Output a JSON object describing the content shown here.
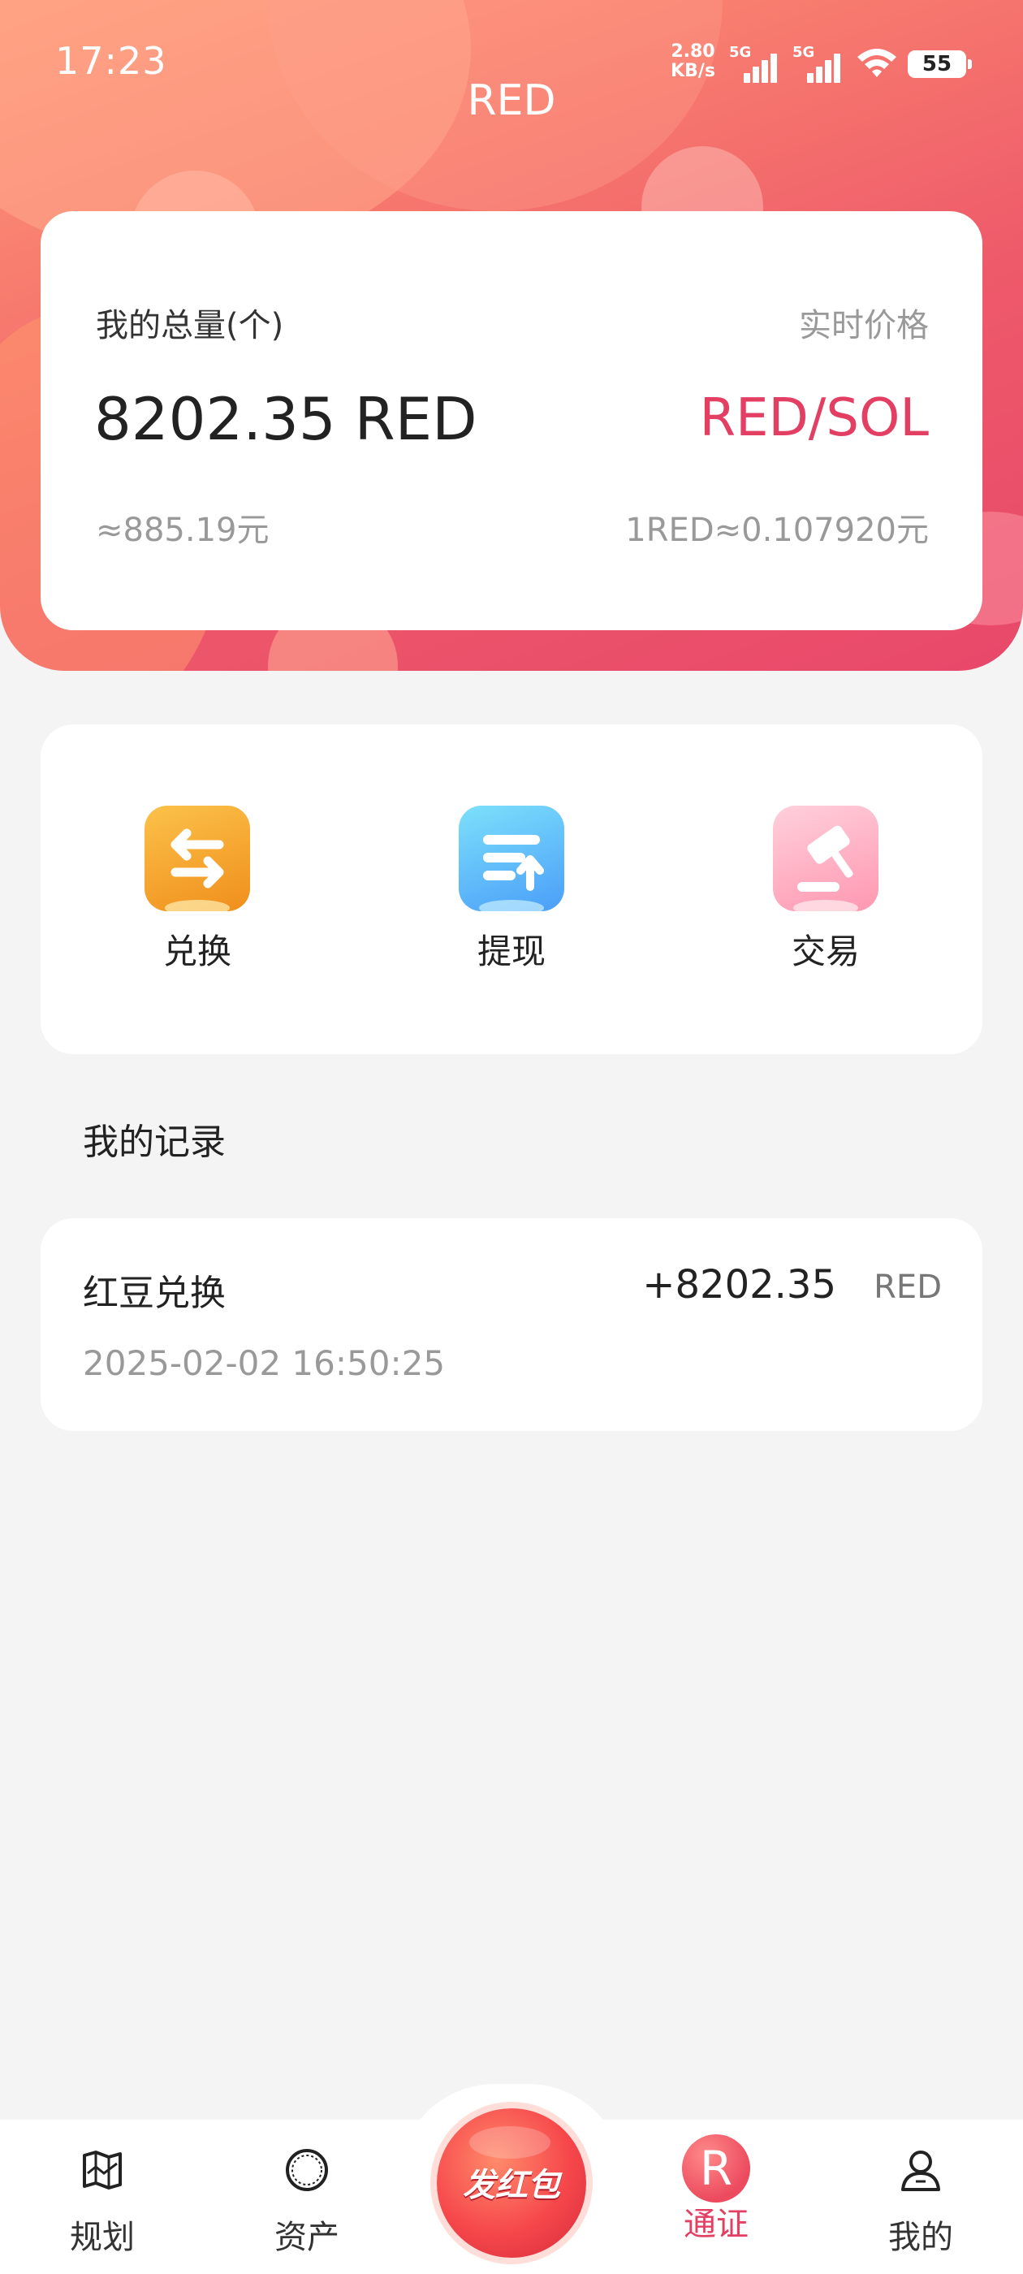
{
  "status_bar": {
    "time": "17:23",
    "net_speed_value": "2.80",
    "net_speed_unit": "KB/s",
    "sim1_tag": "5G",
    "sim2_tag": "5G",
    "battery": "55"
  },
  "header": {
    "title": "RED"
  },
  "summary": {
    "total_label": "我的总量(个)",
    "price_label": "实时价格",
    "total_amount": "8202.35 RED",
    "pair": "RED/SOL",
    "cny_value": "≈885.19元",
    "rate": "1RED≈0.107920元"
  },
  "actions": [
    {
      "label": "兑换",
      "icon": "exchange-icon",
      "color": "#f4a02c"
    },
    {
      "label": "提现",
      "icon": "withdraw-icon",
      "color": "#4fb4fb"
    },
    {
      "label": "交易",
      "icon": "gavel-icon",
      "color": "#ff9fb3"
    }
  ],
  "records": {
    "title": "我的记录",
    "items": [
      {
        "title": "红豆兑换",
        "amount": "+8202.35",
        "unit": "RED",
        "time": "2025-02-02 16:50:25"
      }
    ]
  },
  "tabbar": {
    "items": [
      {
        "label": "规划",
        "icon": "map-icon"
      },
      {
        "label": "资产",
        "icon": "asset-icon"
      },
      {
        "label": "发红包",
        "icon": "red-packet-icon"
      },
      {
        "label": "通证",
        "icon": "token-r-icon",
        "badge": "R",
        "active": true
      },
      {
        "label": "我的",
        "icon": "user-icon"
      }
    ]
  },
  "colors": {
    "accent": "#e23f63",
    "header_gradient_start": "#ff9a7a",
    "header_gradient_end": "#e8486a",
    "page_background": "#f4f4f4"
  }
}
